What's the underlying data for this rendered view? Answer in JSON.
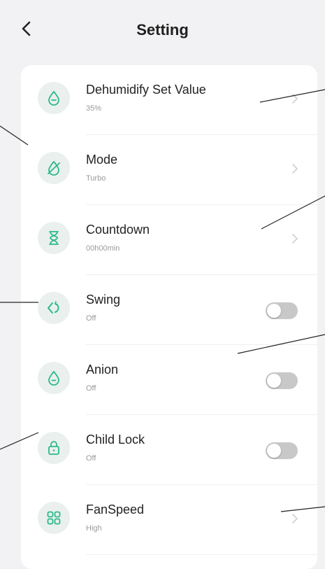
{
  "header": {
    "title": "Setting",
    "back_icon": "chevron-left-icon"
  },
  "settings": [
    {
      "label": "Dehumidify Set Value",
      "value": "35%",
      "icon": "droplet-icon",
      "control": "chevron"
    },
    {
      "label": "Mode",
      "value": "Turbo",
      "icon": "mode-icon",
      "control": "chevron"
    },
    {
      "label": "Countdown",
      "value": "00h00min",
      "icon": "hourglass-icon",
      "control": "chevron"
    },
    {
      "label": "Swing",
      "value": "Off",
      "icon": "swing-icon",
      "control": "toggle",
      "on": false
    },
    {
      "label": "Anion",
      "value": "Off",
      "icon": "anion-icon",
      "control": "toggle",
      "on": false
    },
    {
      "label": "Child Lock",
      "value": "Off",
      "icon": "lock-icon",
      "control": "toggle",
      "on": false
    },
    {
      "label": "FanSpeed",
      "value": "High",
      "icon": "grid-icon",
      "control": "chevron"
    }
  ],
  "colors": {
    "accent": "#2bb98c",
    "icon_bg": "#e9f0ed",
    "toggle_off": "#c8c8c8",
    "background": "#f2f2f4",
    "callout_line": "#222222"
  }
}
